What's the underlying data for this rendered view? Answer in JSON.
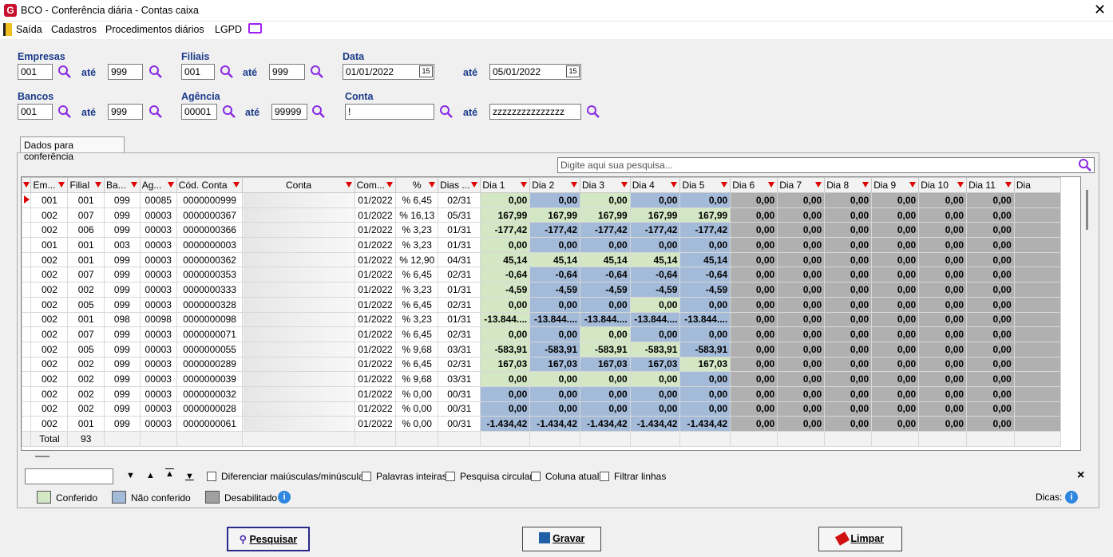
{
  "window": {
    "title": "BCO - Conferência diária - Contas caixa",
    "logo": "G"
  },
  "menu": [
    "Saída",
    "Cadastros",
    "Procedimentos diários",
    "LGPD"
  ],
  "filters": {
    "empresas": {
      "label": "Empresas",
      "from": "001",
      "ate": "até",
      "to": "999"
    },
    "filiais": {
      "label": "Filiais",
      "from": "001",
      "ate": "até",
      "to": "999"
    },
    "data": {
      "label": "Data",
      "from": "01/01/2022",
      "ate": "até",
      "to": "05/01/2022"
    },
    "bancos": {
      "label": "Bancos",
      "from": "001",
      "ate": "até",
      "to": "999"
    },
    "agencia": {
      "label": "Agência",
      "from": "00001",
      "ate": "até",
      "to": "99999"
    },
    "conta": {
      "label": "Conta",
      "from": "!",
      "ate": "até",
      "to": "zzzzzzzzzzzzzzz"
    }
  },
  "tab": "Dados para conferência",
  "grid_search_placeholder": "Digite aqui sua pesquisa...",
  "grid": {
    "columns": [
      "Em...",
      "Filial",
      "Ba...",
      "Ag...",
      "Cód. Conta",
      "Conta",
      "Com...",
      "%",
      "Dias ...",
      "Dia 1",
      "Dia 2",
      "Dia 3",
      "Dia 4",
      "Dia 5",
      "Dia 6",
      "Dia 7",
      "Dia 8",
      "Dia 9",
      "Dia 10",
      "Dia 11",
      "Dia"
    ],
    "rows": [
      {
        "c": [
          "001",
          "001",
          "099",
          "00085",
          "0000000999",
          "01/2022",
          "% 6,45",
          "02/31"
        ],
        "d": [
          "0,00",
          "0,00",
          "0,00",
          "0,00",
          "0,00"
        ],
        "col": [
          "g",
          "b",
          "g",
          "b",
          "b"
        ]
      },
      {
        "c": [
          "002",
          "007",
          "099",
          "00003",
          "0000000367",
          "01/2022",
          "% 16,13",
          "05/31"
        ],
        "d": [
          "167,99",
          "167,99",
          "167,99",
          "167,99",
          "167,99"
        ],
        "col": [
          "g",
          "g",
          "g",
          "g",
          "g"
        ]
      },
      {
        "c": [
          "002",
          "006",
          "099",
          "00003",
          "0000000366",
          "01/2022",
          "% 3,23",
          "01/31"
        ],
        "d": [
          "-177,42",
          "-177,42",
          "-177,42",
          "-177,42",
          "-177,42"
        ],
        "col": [
          "g",
          "b",
          "b",
          "b",
          "b"
        ]
      },
      {
        "c": [
          "001",
          "001",
          "003",
          "00003",
          "0000000003",
          "01/2022",
          "% 3,23",
          "01/31"
        ],
        "d": [
          "0,00",
          "0,00",
          "0,00",
          "0,00",
          "0,00"
        ],
        "col": [
          "g",
          "b",
          "b",
          "b",
          "b"
        ]
      },
      {
        "c": [
          "002",
          "001",
          "099",
          "00003",
          "0000000362",
          "01/2022",
          "% 12,90",
          "04/31"
        ],
        "d": [
          "45,14",
          "45,14",
          "45,14",
          "45,14",
          "45,14"
        ],
        "col": [
          "g",
          "g",
          "g",
          "g",
          "b"
        ]
      },
      {
        "c": [
          "002",
          "007",
          "099",
          "00003",
          "0000000353",
          "01/2022",
          "% 6,45",
          "02/31"
        ],
        "d": [
          "-0,64",
          "-0,64",
          "-0,64",
          "-0,64",
          "-0,64"
        ],
        "col": [
          "g",
          "b",
          "b",
          "b",
          "b"
        ]
      },
      {
        "c": [
          "002",
          "002",
          "099",
          "00003",
          "0000000333",
          "01/2022",
          "% 3,23",
          "01/31"
        ],
        "d": [
          "-4,59",
          "-4,59",
          "-4,59",
          "-4,59",
          "-4,59"
        ],
        "col": [
          "g",
          "b",
          "b",
          "b",
          "b"
        ]
      },
      {
        "c": [
          "002",
          "005",
          "099",
          "00003",
          "0000000328",
          "01/2022",
          "% 6,45",
          "02/31"
        ],
        "d": [
          "0,00",
          "0,00",
          "0,00",
          "0,00",
          "0,00"
        ],
        "col": [
          "g",
          "b",
          "b",
          "g",
          "b"
        ]
      },
      {
        "c": [
          "002",
          "001",
          "098",
          "00098",
          "0000000098",
          "01/2022",
          "% 3,23",
          "01/31"
        ],
        "d": [
          "-13.844....",
          "-13.844....",
          "-13.844....",
          "-13.844....",
          "-13.844...."
        ],
        "col": [
          "g",
          "b",
          "b",
          "b",
          "b"
        ]
      },
      {
        "c": [
          "002",
          "007",
          "099",
          "00003",
          "0000000071",
          "01/2022",
          "% 6,45",
          "02/31"
        ],
        "d": [
          "0,00",
          "0,00",
          "0,00",
          "0,00",
          "0,00"
        ],
        "col": [
          "g",
          "b",
          "g",
          "b",
          "b"
        ]
      },
      {
        "c": [
          "002",
          "005",
          "099",
          "00003",
          "0000000055",
          "01/2022",
          "% 9,68",
          "03/31"
        ],
        "d": [
          "-583,91",
          "-583,91",
          "-583,91",
          "-583,91",
          "-583,91"
        ],
        "col": [
          "g",
          "b",
          "g",
          "g",
          "b"
        ]
      },
      {
        "c": [
          "002",
          "002",
          "099",
          "00003",
          "0000000289",
          "01/2022",
          "% 6,45",
          "02/31"
        ],
        "d": [
          "167,03",
          "167,03",
          "167,03",
          "167,03",
          "167,03"
        ],
        "col": [
          "g",
          "b",
          "b",
          "b",
          "g"
        ]
      },
      {
        "c": [
          "002",
          "002",
          "099",
          "00003",
          "0000000039",
          "01/2022",
          "% 9,68",
          "03/31"
        ],
        "d": [
          "0,00",
          "0,00",
          "0,00",
          "0,00",
          "0,00"
        ],
        "col": [
          "g",
          "g",
          "g",
          "g",
          "b"
        ]
      },
      {
        "c": [
          "002",
          "002",
          "099",
          "00003",
          "0000000032",
          "01/2022",
          "% 0,00",
          "00/31"
        ],
        "d": [
          "0,00",
          "0,00",
          "0,00",
          "0,00",
          "0,00"
        ],
        "col": [
          "b",
          "b",
          "b",
          "b",
          "b"
        ]
      },
      {
        "c": [
          "002",
          "002",
          "099",
          "00003",
          "0000000028",
          "01/2022",
          "% 0,00",
          "00/31"
        ],
        "d": [
          "0,00",
          "0,00",
          "0,00",
          "0,00",
          "0,00"
        ],
        "col": [
          "b",
          "b",
          "b",
          "b",
          "b"
        ]
      },
      {
        "c": [
          "002",
          "001",
          "099",
          "00003",
          "0000000061",
          "01/2022",
          "% 0,00",
          "00/31"
        ],
        "d": [
          "-1.434,42",
          "-1.434,42",
          "-1.434,42",
          "-1.434,42",
          "-1.434,42"
        ],
        "col": [
          "b",
          "b",
          "b",
          "b",
          "b"
        ]
      }
    ],
    "disabled_value": "0,00",
    "footer": {
      "label": "Total",
      "count": "93"
    }
  },
  "findbar": {
    "options": [
      "Diferenciar maiúsculas/minúsculas",
      "Palavras inteiras",
      "Pesquisa circular",
      "Coluna atual",
      "Filtrar linhas"
    ],
    "close": "×"
  },
  "legend": [
    {
      "label": "Conferido",
      "color": "#d3e7c4"
    },
    {
      "label": "Não conferido",
      "color": "#a3bad8"
    },
    {
      "label": "Desabilitado",
      "color": "#a0a0a0"
    }
  ],
  "dicas": "Dicas:",
  "buttons": {
    "pesquisar": "Pesquisar",
    "gravar": "Gravar",
    "limpar": "Limpar"
  }
}
